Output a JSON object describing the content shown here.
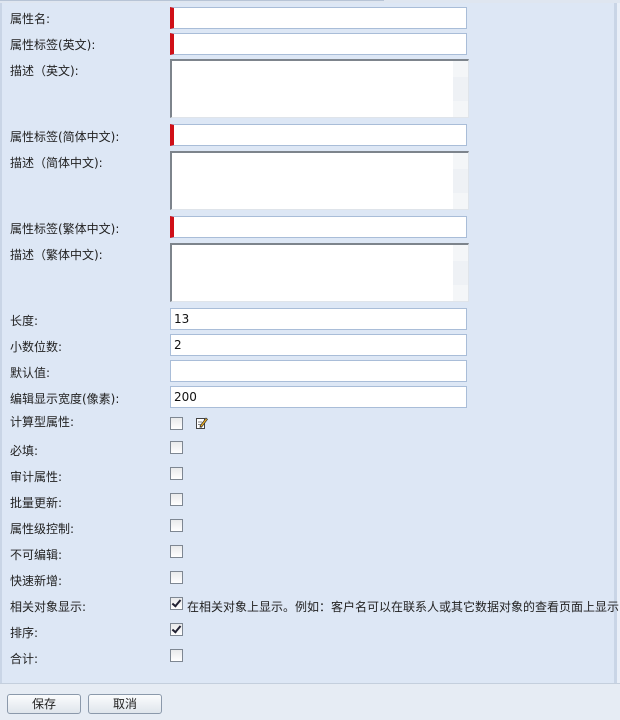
{
  "fields": {
    "attr_name": {
      "label": "属性名:",
      "value": ""
    },
    "label_en": {
      "label": "属性标签(英文):",
      "value": ""
    },
    "desc_en": {
      "label": "描述（英文):"
    },
    "label_zh_cn": {
      "label": "属性标签(简体中文):",
      "value": ""
    },
    "desc_zh_cn": {
      "label": "描述（简体中文):"
    },
    "label_zh_tw": {
      "label": "属性标签(繁体中文):",
      "value": ""
    },
    "desc_zh_tw": {
      "label": "描述（繁体中文):"
    },
    "length": {
      "label": "长度:",
      "value": "13"
    },
    "decimals": {
      "label": "小数位数:",
      "value": "2"
    },
    "default_value": {
      "label": "默认值:",
      "value": ""
    },
    "display_width": {
      "label": "编辑显示宽度(像素):",
      "value": "200"
    }
  },
  "checks": {
    "computed": {
      "label": "计算型属性:",
      "checked": false,
      "icon": "pencil-edit-icon"
    },
    "required": {
      "label": "必填:",
      "checked": false
    },
    "audit": {
      "label": "审计属性:",
      "checked": false
    },
    "batch_update": {
      "label": "批量更新:",
      "checked": false
    },
    "attr_level_control": {
      "label": "属性级控制:",
      "checked": false
    },
    "not_editable": {
      "label": "不可编辑:",
      "checked": false
    },
    "quick_add": {
      "label": "快速新增:",
      "checked": false
    },
    "related_display": {
      "label": "相关对象显示:",
      "checked": true,
      "text": "在相关对象上显示。例如：客户名可以在联系人或其它数据对象的查看页面上显示"
    },
    "sort": {
      "label": "排序:",
      "checked": true
    },
    "total": {
      "label": "合计:",
      "checked": false
    }
  },
  "footer": {
    "save_label": "保存",
    "cancel_label": "取消"
  },
  "colors": {
    "required_marker": "#d01018",
    "form_background": "#dde7f5"
  }
}
